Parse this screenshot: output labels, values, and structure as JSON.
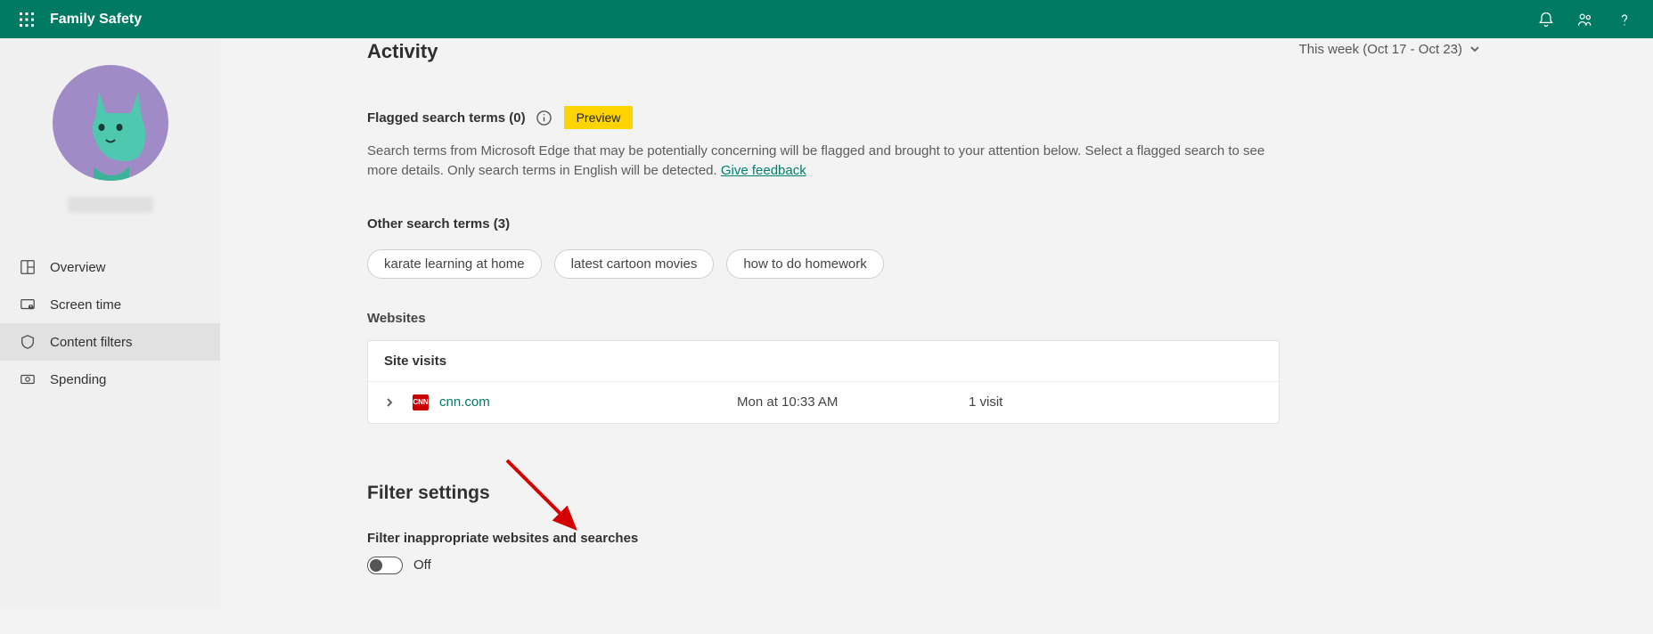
{
  "header": {
    "title": "Family Safety"
  },
  "sidebar": {
    "items": [
      {
        "label": "Overview"
      },
      {
        "label": "Screen time"
      },
      {
        "label": "Content filters"
      },
      {
        "label": "Spending"
      }
    ],
    "active_index": 2
  },
  "activity": {
    "title": "Activity",
    "week_label": "This week (Oct 17 - Oct 23)",
    "flagged_label": "Flagged search terms (0)",
    "preview_chip": "Preview",
    "flagged_desc_1": "Search terms from Microsoft Edge that may be potentially concerning will be flagged and brought to your attention below. Select a flagged search to see more details. Only search terms in English will be detected. ",
    "feedback_link": "Give feedback",
    "other_label": "Other search terms (3)",
    "other_terms": [
      "karate learning at home",
      "latest cartoon movies",
      "how to do homework"
    ],
    "websites_label": "Websites",
    "site_visits_label": "Site visits",
    "visits": [
      {
        "favicon_text": "CNN",
        "site": "cnn.com",
        "time": "Mon at 10:33 AM",
        "count": "1 visit"
      }
    ]
  },
  "filter": {
    "title": "Filter settings",
    "toggle_label": "Filter inappropriate websites and searches",
    "toggle_state": "Off"
  }
}
